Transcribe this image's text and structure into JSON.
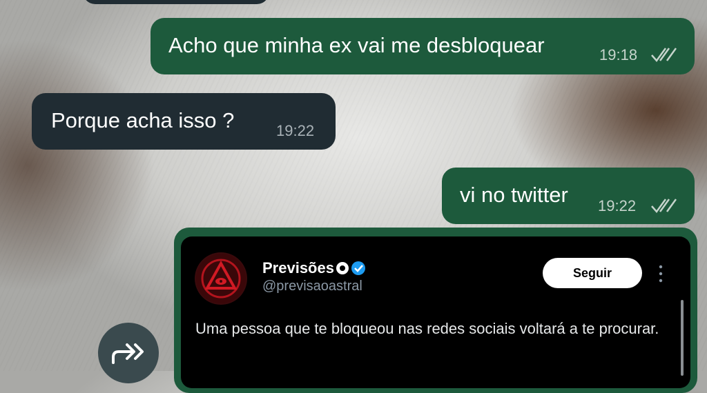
{
  "messages": [
    {
      "direction": "out",
      "text": "Acho que minha ex vai me desbloquear",
      "time": "19:18",
      "status": "read"
    },
    {
      "direction": "in",
      "text": "Porque acha isso ?",
      "time": "19:22"
    },
    {
      "direction": "out",
      "text": "vi no twitter",
      "time": "19:22",
      "status": "read"
    }
  ],
  "tweet": {
    "name": "Previsões",
    "handle": "@previsaoastral",
    "follow_label": "Seguir",
    "text": "Uma pessoa que te bloqueou nas redes sociais voltará a te procurar."
  },
  "colors": {
    "outgoing": "#1d5a3c",
    "incoming": "#202c33",
    "verified": "#1d9bf0"
  },
  "icons": {
    "read": "double-check-icon",
    "forward": "forward-icon",
    "more": "more-vertical-icon"
  }
}
